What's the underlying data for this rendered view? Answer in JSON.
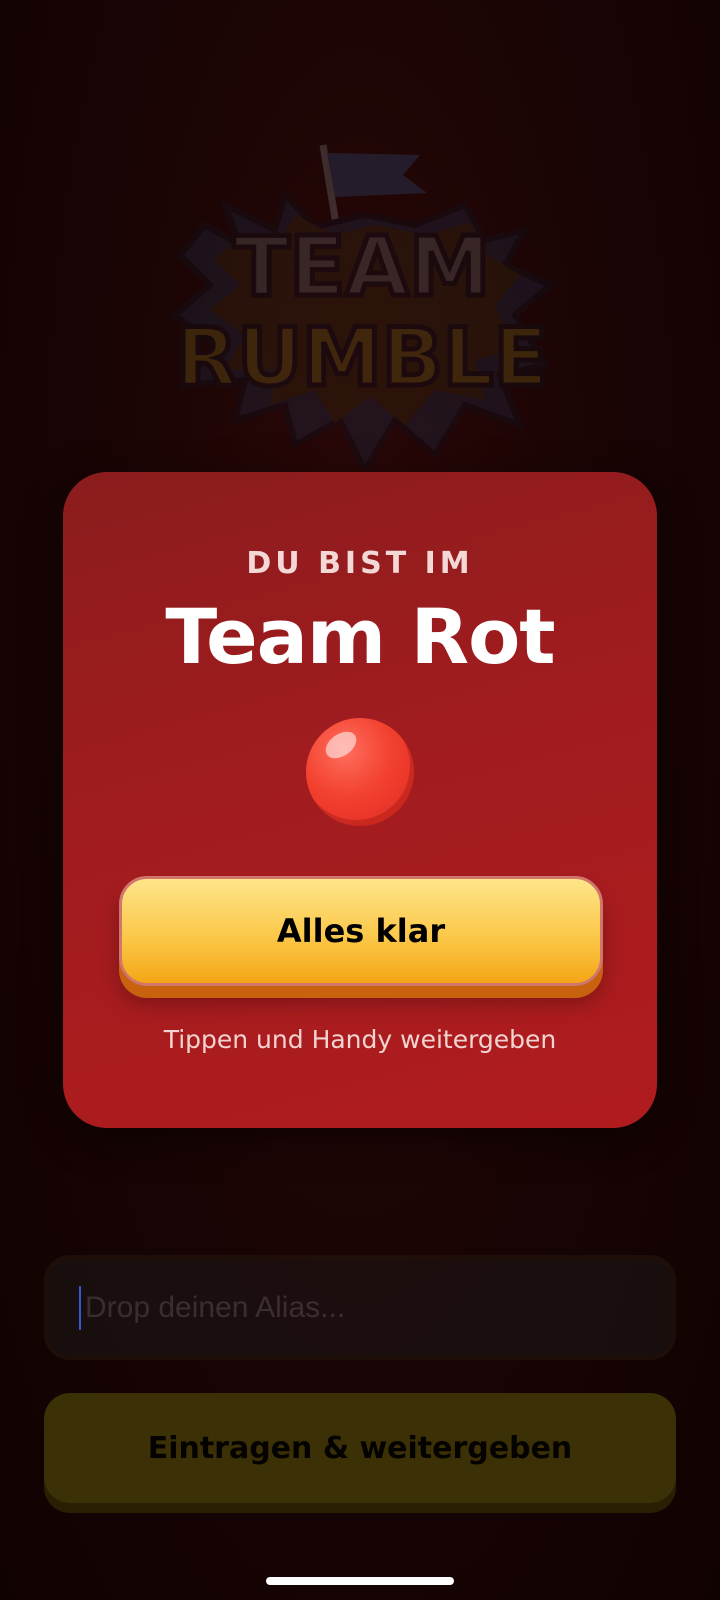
{
  "logo": {
    "line1": "TEAM",
    "line2": "RUMBLE"
  },
  "card": {
    "subtitle": "DU BIST IM",
    "title": "Team Rot",
    "button_label": "Alles klar",
    "hint": "Tippen und Handy weitergeben",
    "team_color": "#f3412f"
  },
  "form": {
    "alias_placeholder": "Drop deinen Alias...",
    "submit_label": "Eintragen & weitergeben"
  },
  "colors": {
    "card": "#a11c1f",
    "button": "#fbc84a",
    "background": "#180404"
  }
}
